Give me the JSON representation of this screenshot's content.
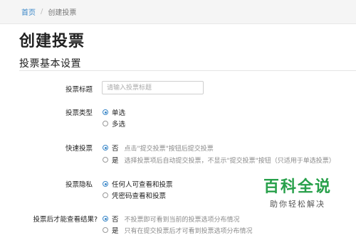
{
  "breadcrumb": {
    "home": "首页",
    "separator": "/",
    "current": "创建投票"
  },
  "page_title": "创建投票",
  "section_title": "投票基本设置",
  "form": {
    "title_field": {
      "label": "投票标题",
      "placeholder": "请输入投票标题",
      "value": ""
    },
    "type": {
      "label": "投票类型",
      "options": [
        {
          "label": "单选",
          "checked": true
        },
        {
          "label": "多选",
          "checked": false
        }
      ]
    },
    "quick_vote": {
      "label": "快速投票",
      "options": [
        {
          "label": "否",
          "hint": "点击\"提交投票\"按钮后提交投票",
          "checked": true
        },
        {
          "label": "是",
          "hint": "选择投票项后自动提交投票，不显示\"提交投票\"按钮（只适用于单选投票）",
          "checked": false
        }
      ]
    },
    "privacy": {
      "label": "投票隐私",
      "options": [
        {
          "label": "任何人可查看和投票",
          "checked": true
        },
        {
          "label": "凭密码查看和投票",
          "checked": false
        }
      ]
    },
    "result_visibility": {
      "label": "投票后才能查看结果?",
      "options": [
        {
          "label": "否",
          "hint": "不投票即可看到当前的投票选项分布情况",
          "checked": true
        },
        {
          "label": "是",
          "hint": "只有在提交投票后才可看到投票选项分布情况",
          "checked": false
        }
      ]
    }
  },
  "watermark": {
    "title": "百科全说",
    "subtitle": "助你轻松解决"
  },
  "colors": {
    "accent": "#3a87c8",
    "watermark_green": "#27a04a"
  }
}
